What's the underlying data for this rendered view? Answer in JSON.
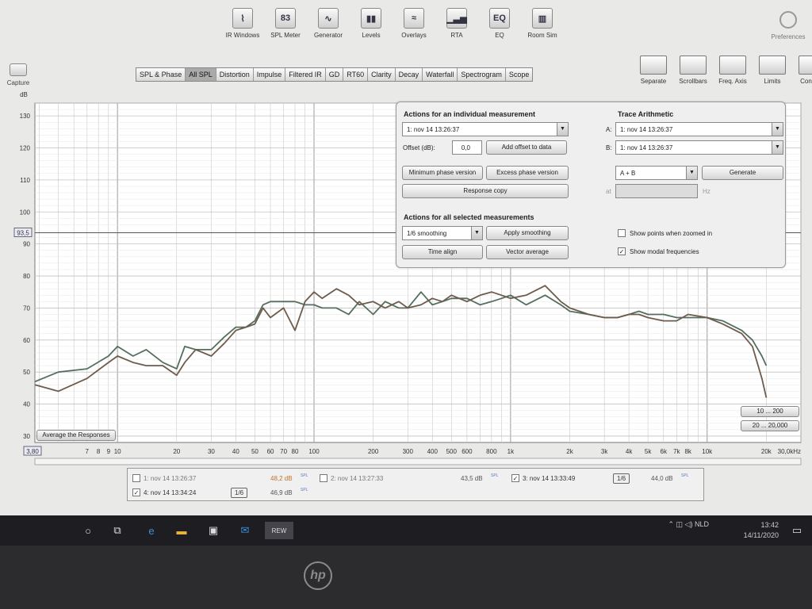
{
  "toolbar": {
    "items": [
      {
        "label": "IR Windows",
        "icon": "ir-windows-icon",
        "glyph": "⌇"
      },
      {
        "label": "SPL Meter",
        "icon": "spl-meter-icon",
        "glyph": "83"
      },
      {
        "label": "Generator",
        "icon": "generator-icon",
        "glyph": "∿"
      },
      {
        "label": "Levels",
        "icon": "levels-icon",
        "glyph": "▮▮"
      },
      {
        "label": "Overlays",
        "icon": "overlays-icon",
        "glyph": "≈"
      },
      {
        "label": "RTA",
        "icon": "rta-icon",
        "glyph": "▁▃▅"
      },
      {
        "label": "EQ",
        "icon": "eq-icon",
        "glyph": "EQ"
      },
      {
        "label": "Room Sim",
        "icon": "room-sim-icon",
        "glyph": "▥"
      }
    ],
    "capture_label": "Capture",
    "preferences_label": "Preferences"
  },
  "tabs": [
    "SPL & Phase",
    "All SPL",
    "Distortion",
    "Impulse",
    "Filtered IR",
    "GD",
    "RT60",
    "Clarity",
    "Decay",
    "Waterfall",
    "Spectrogram",
    "Scope"
  ],
  "active_tab": "All SPL",
  "right_tools": [
    "Separate",
    "Scrollbars",
    "Freq. Axis",
    "Limits",
    "Controls"
  ],
  "graph": {
    "y_unit": "dB",
    "y_ticks": [
      "130",
      "120",
      "110",
      "100",
      "90",
      "80",
      "70",
      "60",
      "50",
      "40",
      "30"
    ],
    "x_ticks": [
      "7",
      "8",
      "9",
      "10",
      "20",
      "30",
      "40",
      "50",
      "60",
      "70",
      "80",
      "100",
      "200",
      "300",
      "400",
      "500",
      "600",
      "800",
      "1k",
      "2k",
      "3k",
      "4k",
      "5k",
      "6k",
      "7k",
      "8k",
      "10k",
      "20k",
      "30,0kHz"
    ],
    "cursor_level": "93,5",
    "x_start": "3,80",
    "average_button": "Average the Responses",
    "range_buttons": [
      "10 ... 200",
      "20 ... 20,000"
    ]
  },
  "chart_data": {
    "type": "line",
    "xlabel": "",
    "ylabel": "dB",
    "xscale": "log",
    "xlim": [
      3.8,
      30000
    ],
    "ylim": [
      28,
      134
    ],
    "series": [
      {
        "name": "3: nov 14 13:33:49",
        "color": "#556f5f",
        "x": [
          3.8,
          5,
          7,
          9,
          10,
          12,
          14,
          17,
          20,
          22,
          25,
          30,
          35,
          40,
          45,
          50,
          55,
          60,
          70,
          80,
          90,
          100,
          110,
          130,
          150,
          170,
          200,
          230,
          270,
          300,
          350,
          400,
          450,
          500,
          600,
          700,
          800,
          900,
          1000,
          1200,
          1500,
          1800,
          2000,
          2500,
          3000,
          3500,
          4000,
          4500,
          5000,
          6000,
          7000,
          8000,
          10000,
          12000,
          15000,
          17000,
          19000,
          20000
        ],
        "y": [
          47,
          50,
          51,
          55,
          58,
          55,
          57,
          53,
          51,
          58,
          57,
          57,
          61,
          64,
          64,
          66,
          71,
          72,
          72,
          72,
          71,
          71,
          70,
          70,
          68,
          72,
          68,
          72,
          70,
          70,
          75,
          71,
          72,
          73,
          73,
          71,
          72,
          73,
          74,
          71,
          74,
          71,
          69,
          68,
          67,
          67,
          68,
          69,
          68,
          68,
          67,
          67,
          67,
          66,
          63,
          60,
          55,
          52
        ]
      },
      {
        "name": "4: nov 14 13:34:24",
        "color": "#6e5b4c",
        "x": [
          3.8,
          5,
          7,
          9,
          10,
          12,
          14,
          17,
          20,
          22,
          25,
          30,
          35,
          40,
          45,
          50,
          55,
          60,
          70,
          80,
          90,
          100,
          110,
          130,
          150,
          170,
          200,
          230,
          270,
          300,
          350,
          400,
          450,
          500,
          600,
          700,
          800,
          900,
          1000,
          1200,
          1500,
          1800,
          2000,
          2500,
          3000,
          3500,
          4000,
          4500,
          5000,
          6000,
          7000,
          8000,
          10000,
          12000,
          15000,
          17000,
          19000,
          20000
        ],
        "y": [
          46,
          44,
          48,
          53,
          55,
          53,
          52,
          52,
          49,
          53,
          57,
          55,
          59,
          63,
          64,
          65,
          70,
          67,
          70,
          63,
          72,
          75,
          73,
          76,
          74,
          71,
          72,
          70,
          72,
          70,
          71,
          73,
          72,
          74,
          72,
          74,
          75,
          74,
          73,
          74,
          77,
          72,
          70,
          68,
          67,
          67,
          68,
          68,
          67,
          66,
          66,
          68,
          67,
          65,
          62,
          58,
          48,
          42
        ]
      }
    ]
  },
  "panel": {
    "individual_title": "Actions for an individual measurement",
    "selected_measurement": "1: nov 14 13:26:37",
    "offset_label": "Offset (dB):",
    "offset_value": "0,0",
    "add_offset": "Add offset to data",
    "min_phase": "Minimum phase version",
    "excess_phase": "Excess phase version",
    "response_copy": "Response copy",
    "all_title": "Actions for all selected measurements",
    "smoothing_value": "1/6 smoothing",
    "apply_smoothing": "Apply smoothing",
    "time_align": "Time align",
    "vector_average": "Vector average",
    "trace_title": "Trace Arithmetic",
    "a_label": "A:",
    "a_value": "1: nov 14 13:26:37",
    "b_label": "B:",
    "b_value": "1: nov 14 13:26:37",
    "op_value": "A + B",
    "generate": "Generate",
    "at_label": "at",
    "hz_label": "Hz",
    "show_points": "Show points when zoomed in",
    "show_points_checked": false,
    "show_modal": "Show modal frequencies",
    "show_modal_checked": true
  },
  "measurements": [
    {
      "name": "1: nov 14 13:26:37",
      "level": "48,2 dB",
      "checked": false,
      "smooth": "",
      "color": "#c0722a"
    },
    {
      "name": "2: nov 14 13:27:33",
      "level": "43,5 dB",
      "checked": false,
      "smooth": "",
      "color": "#555555"
    },
    {
      "name": "3: nov 14 13:33:49",
      "level": "44,0 dB",
      "checked": true,
      "smooth": "1/6",
      "color": "#555555"
    },
    {
      "name": "4: nov 14 13:34:24",
      "level": "46,9 dB",
      "checked": true,
      "smooth": "1/6",
      "color": "#555555"
    }
  ],
  "level_unit_suffix": "SPL",
  "taskbar": {
    "lang": "NLD",
    "time": "13:42",
    "date": "14/11/2020",
    "app_label": "REW"
  },
  "brand": "hp"
}
